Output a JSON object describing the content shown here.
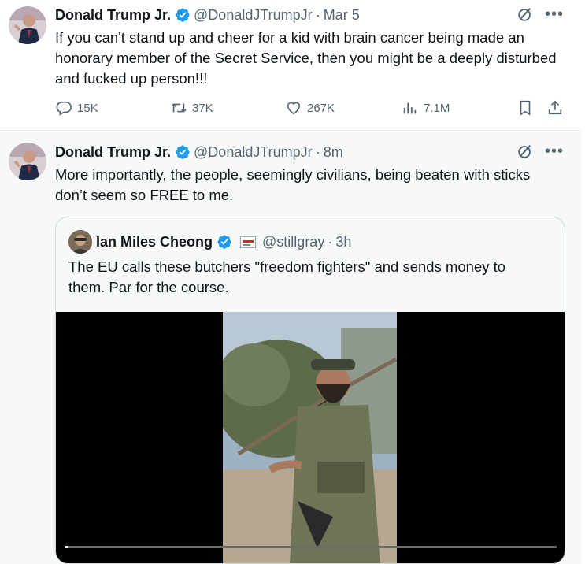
{
  "tweets": [
    {
      "author": {
        "name": "Donald Trump Jr.",
        "handle": "@DonaldJTrumpJr",
        "verified": true
      },
      "time": "Mar 5",
      "text": "If you can't stand up and cheer for a kid with brain cancer being made an honorary member of the Secret Service, then you might be a deeply disturbed and fucked up person!!!",
      "stats": {
        "replies": "15K",
        "reposts": "37K",
        "likes": "267K",
        "views": "7.1M"
      }
    },
    {
      "author": {
        "name": "Donald Trump Jr.",
        "handle": "@DonaldJTrumpJr",
        "verified": true
      },
      "time": "8m",
      "text": "More importantly, the people, seemingly civilians, being beaten with sticks don’t seem so FREE to me.",
      "quote": {
        "author": {
          "name": "Ian Miles Cheong",
          "handle": "@stillgray",
          "verified": true
        },
        "time": "3h",
        "text": "The EU calls these butchers \"freedom fighters\" and sends money to them. Par for the course.",
        "video": {
          "progress": 0.005
        }
      }
    }
  ],
  "separator": "·",
  "icons": [
    "verified-badge-icon",
    "grok-icon",
    "more-icon",
    "reply-icon",
    "repost-icon",
    "like-icon",
    "views-icon",
    "bookmark-icon",
    "share-icon",
    "flag-icon"
  ],
  "colors": {
    "accent": "#1d9bf0",
    "secondary_text": "#536471",
    "border": "#cfd9de"
  }
}
